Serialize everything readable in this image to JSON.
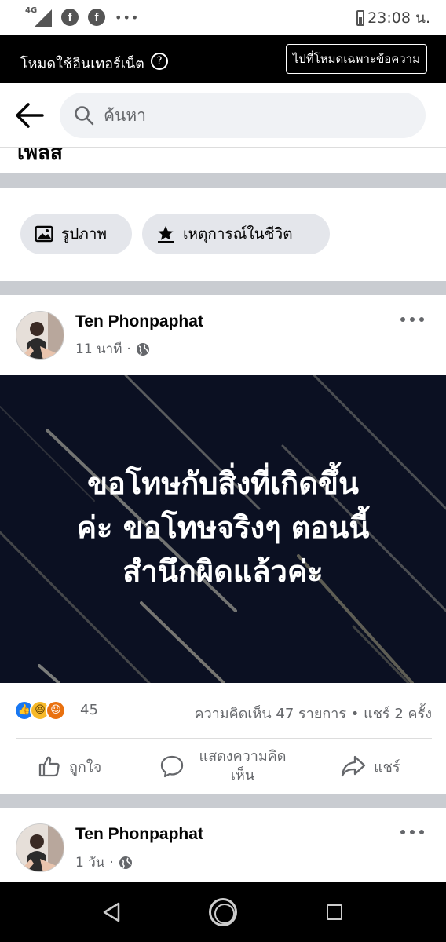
{
  "status_bar": {
    "network": "4G",
    "time": "23:08 น."
  },
  "banner": {
    "text": "โหมดใช้อินเทอร์เน็ต",
    "help_glyph": "?",
    "button_label": "ไปที่โหมดเฉพาะข้อความ"
  },
  "search": {
    "placeholder": "ค้นหา"
  },
  "cutoff_text": "เพลส",
  "chips": {
    "photo_label": "รูปภาพ",
    "life_event_label": "เหตุการณ์ในชีวิต"
  },
  "post1": {
    "author": "Ten Phonpaphat",
    "time": "11 นาที",
    "image_text_lines": [
      "ขอโทษกับสิ่งที่เกิดขึ้น",
      "ค่ะ ขอโทษจริงๆ ตอนนี้",
      "สำนึกผิดแล้วค่ะ"
    ],
    "reaction_count": "45",
    "stats": "ความคิดเห็น 47 รายการ • แชร์ 2 ครั้ง",
    "actions": {
      "like": "ถูกใจ",
      "comment": "แสดงความคิดเห็น",
      "share": "แชร์"
    }
  },
  "post2": {
    "author": "Ten Phonpaphat",
    "time": "1 วัน"
  },
  "icons": [
    "facebook-icon",
    "search-icon",
    "back-arrow-icon",
    "photo-icon",
    "star-flag-icon",
    "globe-icon",
    "more-icon",
    "like-icon",
    "comment-icon",
    "share-icon"
  ]
}
